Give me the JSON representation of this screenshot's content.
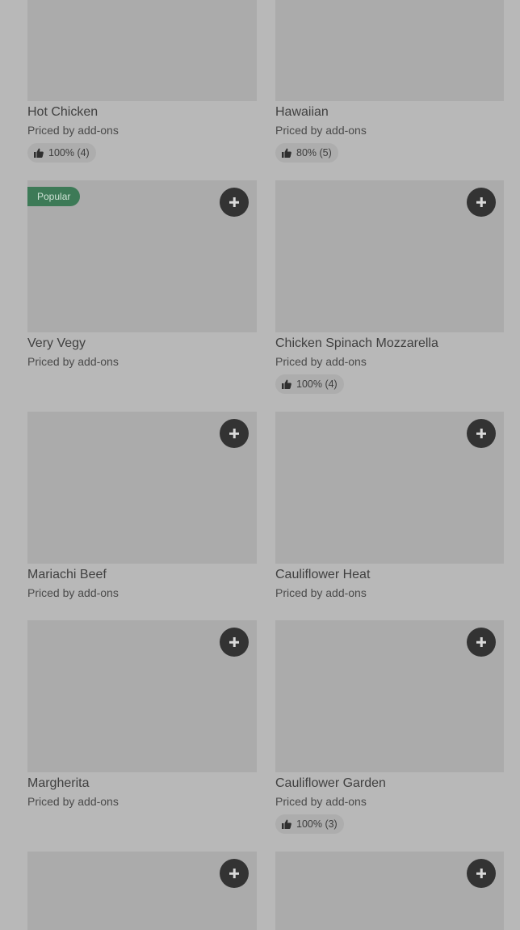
{
  "items": [
    {
      "title": "Hot Chicken",
      "price": "Priced by add-ons",
      "rating": "100% (4)"
    },
    {
      "title": "Hawaiian",
      "price": "Priced by add-ons",
      "rating": "80% (5)"
    },
    {
      "title": "Very Vegy",
      "price": "Priced by add-ons",
      "badge": "Popular"
    },
    {
      "title": "Chicken Spinach Mozzarella",
      "price": "Priced by add-ons",
      "rating": "100% (4)"
    },
    {
      "title": "Mariachi Beef",
      "price": "Priced by add-ons"
    },
    {
      "title": "Cauliflower Heat",
      "price": "Priced by add-ons"
    },
    {
      "title": "Margherita",
      "price": "Priced by add-ons"
    },
    {
      "title": "Cauliflower Garden",
      "price": "Priced by add-ons",
      "rating": "100% (3)"
    }
  ],
  "icons": {
    "add": "plus-icon",
    "rating": "thumbs-up-icon"
  }
}
